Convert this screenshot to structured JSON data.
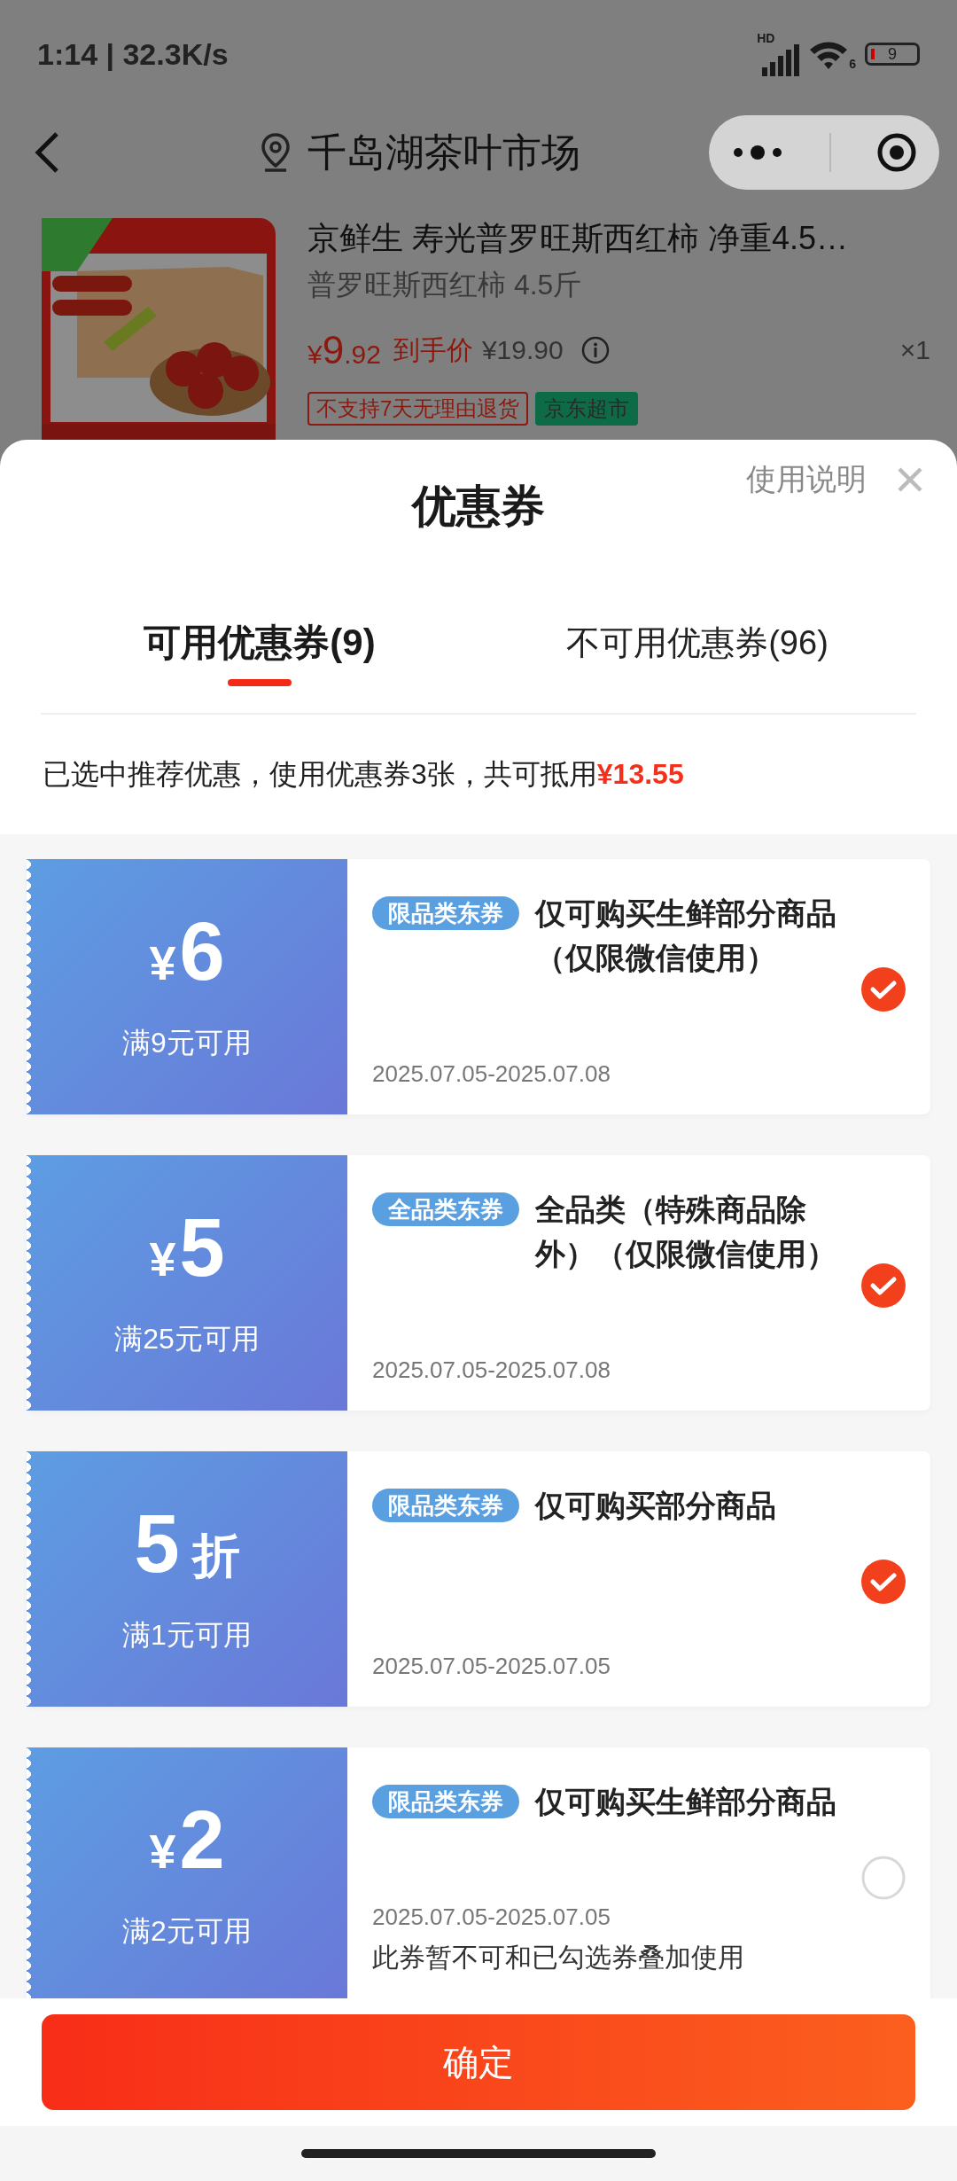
{
  "status_bar": {
    "time": "1:14 | 32.3K/s",
    "signal_label": "HD",
    "wifi_label": "6",
    "battery": "9"
  },
  "nav": {
    "title": "千岛湖茶叶市场"
  },
  "product": {
    "title": "京鲜生 寿光普罗旺斯西红柿 净重4.5…",
    "spec": "普罗旺斯西红柿 4.5斤",
    "price_currency": "¥",
    "price_integer": "9",
    "price_decimal": ".92",
    "price_label": "到手价",
    "original_price": "¥19.90",
    "quantity": "×1",
    "tags": [
      {
        "text": "不支持7天无理由退货",
        "kind": "outline"
      },
      {
        "text": "京东超市",
        "kind": "filled"
      }
    ]
  },
  "sheet": {
    "title": "优惠券",
    "help_link": "使用说明"
  },
  "tabs": [
    {
      "label": "可用优惠券(9)",
      "selected": true
    },
    {
      "label": "不可用优惠券(96)",
      "selected": false
    }
  ],
  "summary": {
    "text": "已选中推荐优惠，使用优惠券3张，共可抵用",
    "amount": "¥13.55"
  },
  "coupons": [
    {
      "kind": "cash",
      "currency": "¥",
      "value": "6",
      "condition": "满9元可用",
      "tag": "限品类东券",
      "title": "仅可购买生鲜部分商品（仅限微信使用）",
      "date": "2025.07.05-2025.07.08",
      "selected": true
    },
    {
      "kind": "cash",
      "currency": "¥",
      "value": "5",
      "condition": "满25元可用",
      "tag": "全品类东券",
      "title": "全品类（特殊商品除外）（仅限微信使用）",
      "date": "2025.07.05-2025.07.08",
      "selected": true
    },
    {
      "kind": "discount",
      "value": "5",
      "unit": "折",
      "condition": "满1元可用",
      "tag": "限品类东券",
      "title": "仅可购买部分商品",
      "date": "2025.07.05-2025.07.05",
      "selected": true
    },
    {
      "kind": "cash",
      "currency": "¥",
      "value": "2",
      "condition": "满2元可用",
      "tag": "限品类东券",
      "title": "仅可购买生鲜部分商品",
      "date": "2025.07.05-2025.07.05",
      "note": "此券暂不可和已勾选券叠加使用",
      "selected": false
    }
  ],
  "confirm_button": "确定"
}
